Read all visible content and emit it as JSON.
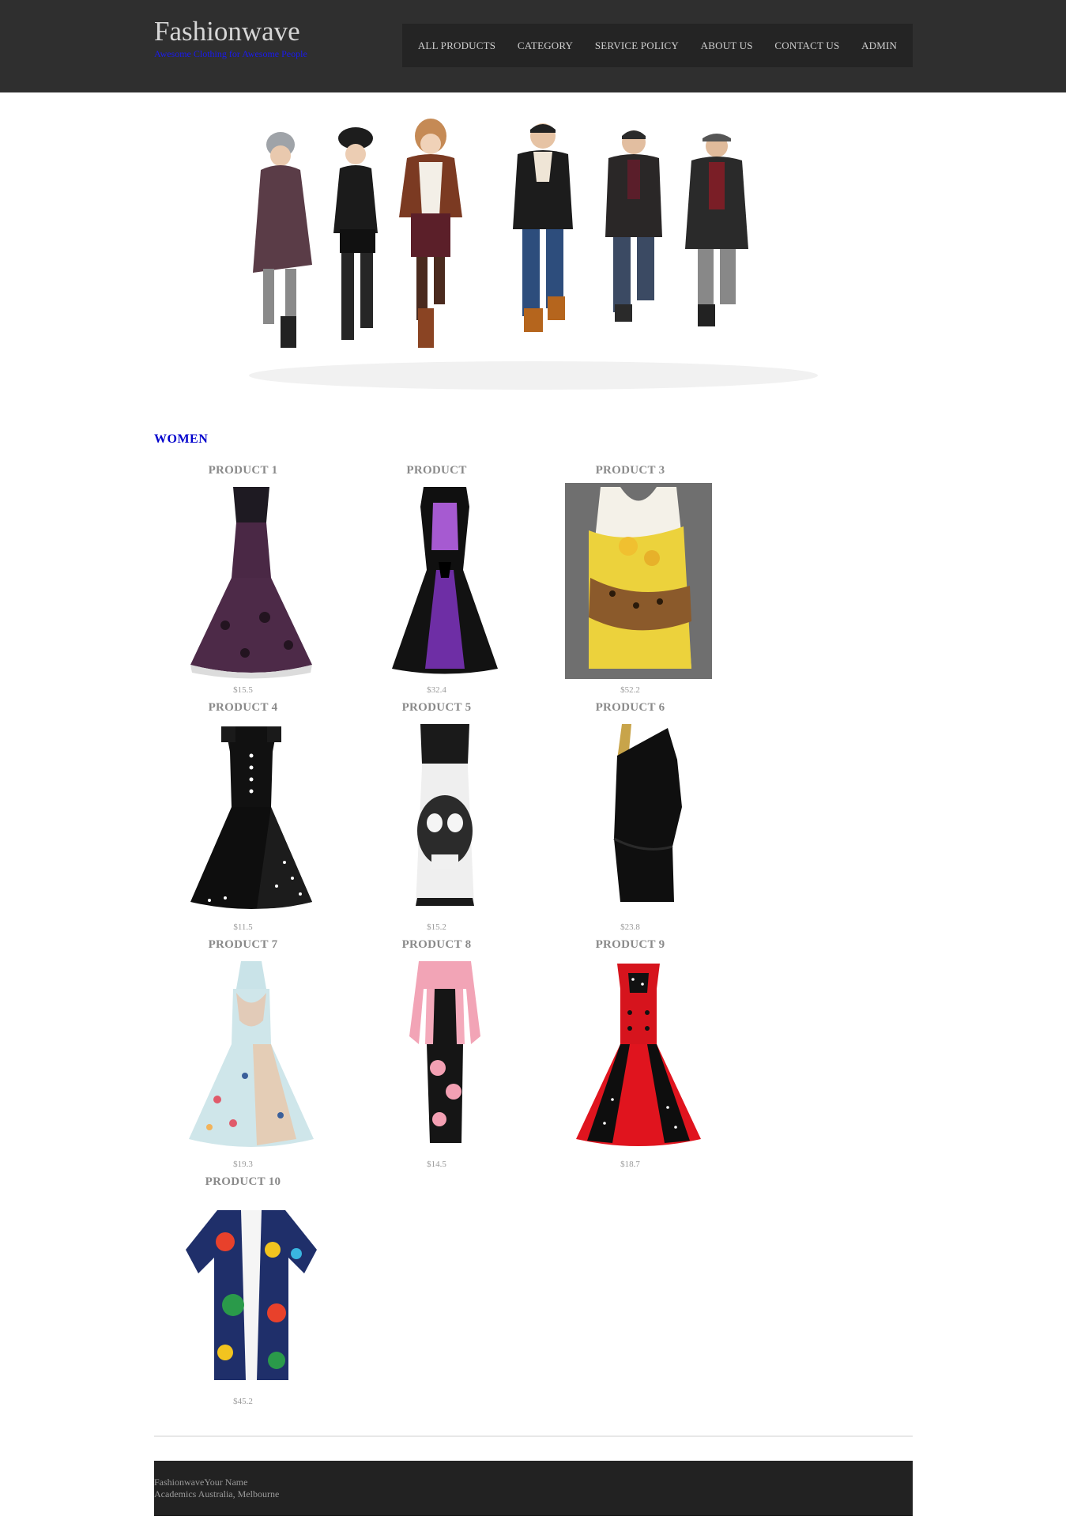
{
  "site": {
    "title": "Fashionwave",
    "tagline": "Awesome Clothing for Awesome People"
  },
  "nav": {
    "items": [
      "ALL PRODUCTS",
      "CATEGORY",
      "SERVICE POLICY",
      "ABOUT US",
      "CONTACT US",
      "ADMIN"
    ]
  },
  "section": {
    "title": "WOMEN"
  },
  "products": [
    {
      "name": "PRODUCT 1",
      "price": "$15.5",
      "image": "purple-lace-dress"
    },
    {
      "name": "PRODUCT",
      "price": "$32.4",
      "image": "black-purple-butterfly-dress"
    },
    {
      "name": "PRODUCT 3",
      "price": "$52.2",
      "image": "yellow-floral-leopard-dress"
    },
    {
      "name": "PRODUCT 4",
      "price": "$11.5",
      "image": "black-polka-dot-dress"
    },
    {
      "name": "PRODUCT 5",
      "price": "$15.2",
      "image": "skull-print-dress"
    },
    {
      "name": "PRODUCT 6",
      "price": "$23.8",
      "image": "black-one-shoulder-dress"
    },
    {
      "name": "PRODUCT 7",
      "price": "$19.3",
      "image": "floral-halter-dress"
    },
    {
      "name": "PRODUCT 8",
      "price": "$14.5",
      "image": "pink-jacket-floral-dress"
    },
    {
      "name": "PRODUCT 9",
      "price": "$18.7",
      "image": "red-polka-dot-dress"
    },
    {
      "name": "PRODUCT 10",
      "price": "$45.2",
      "image": "tropical-print-shirt"
    }
  ],
  "footer": {
    "line1": "FashionwaveYour Name",
    "line2": "Academics Australia, Melbourne"
  }
}
